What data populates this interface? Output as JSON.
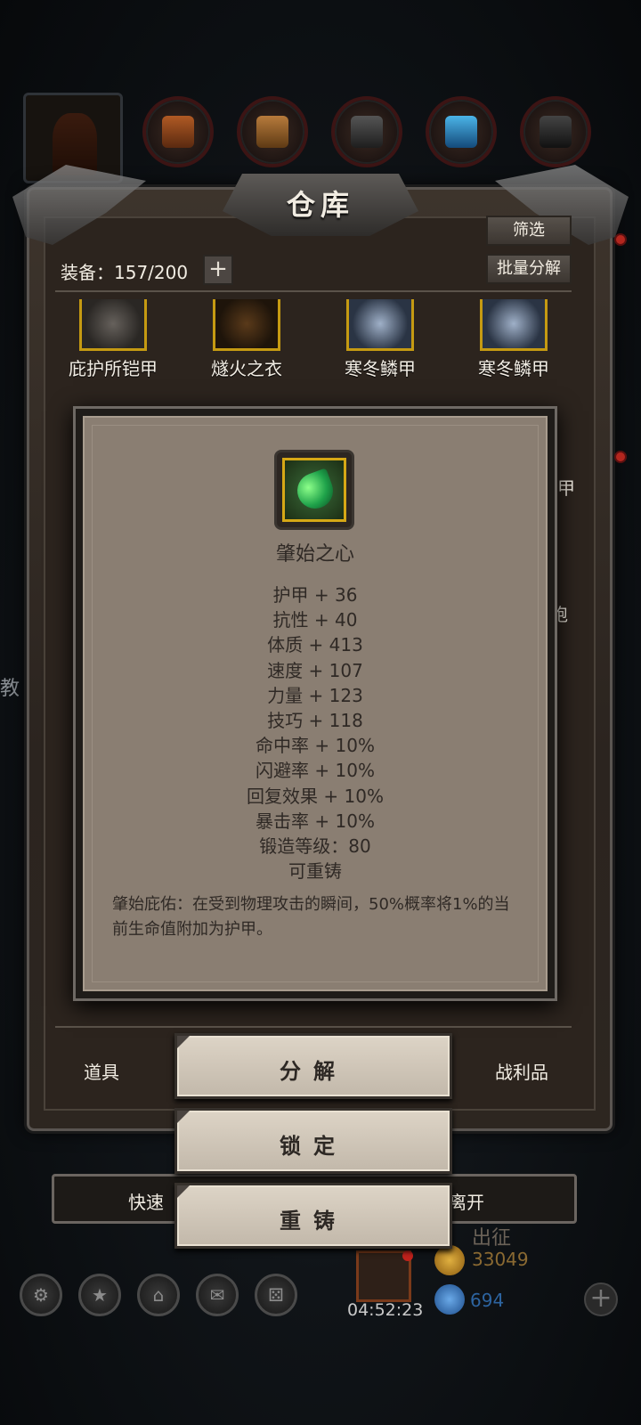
{
  "warehouse": {
    "title": "仓库",
    "equip_label": "装备：157/200",
    "filter_label": "筛选",
    "batch_label": "批量分解",
    "plus_symbol": "+",
    "items": [
      {
        "name": "庇护所铠甲"
      },
      {
        "name": "燧火之衣"
      },
      {
        "name": "寒冬鳞甲"
      },
      {
        "name": "寒冬鳞甲"
      }
    ],
    "side_peek_right_1": "甲",
    "side_peek_right_2": "袍",
    "bottom_tabs": {
      "left": "道具",
      "right": "战利品"
    },
    "quick_left": "快速",
    "quick_right": "离开"
  },
  "background": {
    "left_text": "教"
  },
  "tooltip": {
    "item_name": "肇始之心",
    "icon": "green-gem-heart-icon",
    "stats": [
      "护甲 + 36",
      "抗性 + 40",
      "体质 + 413",
      "速度 + 107",
      "力量 + 123",
      "技巧 + 118",
      "命中率 + 10%",
      "闪避率 + 10%",
      "回复效果 + 10%",
      "暴击率 + 10%",
      "锻造等级：80",
      "可重铸"
    ],
    "skill_description": "肇始庇佑：在受到物理攻击的瞬间，50%概率将1%的当前生命值附加为护甲。"
  },
  "actions": {
    "decompose": "分解",
    "lock": "锁定",
    "reforge": "重铸"
  },
  "hud": {
    "expedition": "出征",
    "gold": "33049",
    "gems": "694",
    "timer": "04:52:23",
    "add_symbol": "+"
  },
  "colors": {
    "panel_brown": "#2c241e",
    "tooltip_parchment": "#8a7e72",
    "button_cream": "#ddd4c6",
    "gold_frame": "#d6a816"
  }
}
